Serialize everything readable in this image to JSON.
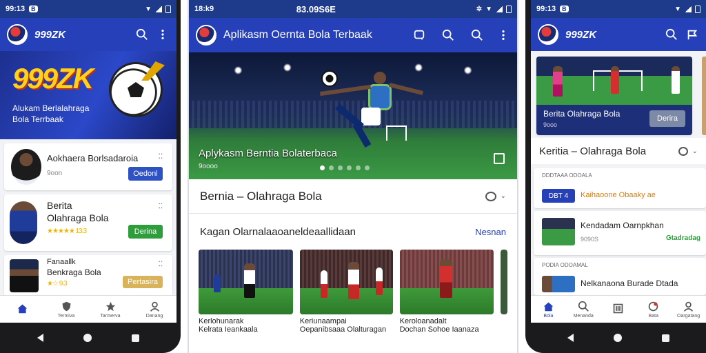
{
  "phone1": {
    "status": {
      "time": "99:13",
      "app_badge": "B"
    },
    "app_title": "999ZK",
    "hero": {
      "brand": "999ZK",
      "line1": "Alukam Berlalahraga",
      "line2": "Bola Terrbaak"
    },
    "items": [
      {
        "title": "Aokhaera Borlsadaroia",
        "subtitle": "9oon",
        "button": "Oedonl",
        "button_color": "#2e52c4"
      },
      {
        "title": "Berita",
        "title2": "Olahraga Bola",
        "stars": "★★★★★ 13.3",
        "button": "Derina",
        "button_color": "#2e9e3c"
      },
      {
        "title": "Fanaallk",
        "title2": "Benkraga Bola",
        "stars": "★☆ 9.3",
        "button": "Pertasira",
        "button_color": "#d8b35a"
      }
    ],
    "bottom_nav": [
      {
        "icon": "home-icon",
        "label": ""
      },
      {
        "icon": "shield-icon",
        "label": "Termiva"
      },
      {
        "icon": "trophy-icon",
        "label": "Tarmerva"
      },
      {
        "icon": "profile-icon",
        "label": "Danang"
      }
    ]
  },
  "phone2": {
    "status": {
      "time": "18:k9",
      "center": "83.09S6E"
    },
    "app_title": "Aplikasm Oernta Bola Terbaak",
    "hero": {
      "caption": "Aplykasm Berntia Bolaterbaca",
      "subcaption": "9oooo"
    },
    "section1": {
      "title": "Bernia – Olahraga Bola"
    },
    "section2": {
      "title": "Kagan Olarnalaaoaneldeaallidaan",
      "link": "Nesnan"
    },
    "cards": [
      {
        "line1": "Kerlohunarak",
        "line2": "Kelrata Ieankaala"
      },
      {
        "line1": "Keriunaampai",
        "line2": "Oepanibsaaa Olalturagan"
      },
      {
        "line1": "Keroloanadalt",
        "line2": "Dochan Sohoe Iaanaza"
      }
    ],
    "accent": "#2540b8"
  },
  "phone3": {
    "status": {
      "time": "99:13",
      "app_badge": "B"
    },
    "app_title": "999ZK",
    "hero": {
      "caption": "Berita Olahraga Bola",
      "subcaption": "9ooo",
      "button": "Derira"
    },
    "section_title": "Keritia – Olahraga Bola",
    "list1": {
      "label": "DDDTAAA ODOALA",
      "tag": "DBT 4",
      "text": "Kaihaoone Obaaky ae"
    },
    "list2": {
      "title": "Kendadam Oarnpkhan",
      "meta": "9090S",
      "tag": "Gtadradag"
    },
    "list3": {
      "label": "PODIA ODOAMAL",
      "title": "Nelkanaona Burade Dtada"
    },
    "bottom_nav": [
      {
        "icon": "home-icon",
        "label": "Bola"
      },
      {
        "icon": "search-icon",
        "label": "Menanda"
      },
      {
        "icon": "news-icon",
        "label": ""
      },
      {
        "icon": "score-icon",
        "label": "Bata"
      },
      {
        "icon": "profile-icon",
        "label": "Oargatang"
      }
    ]
  }
}
